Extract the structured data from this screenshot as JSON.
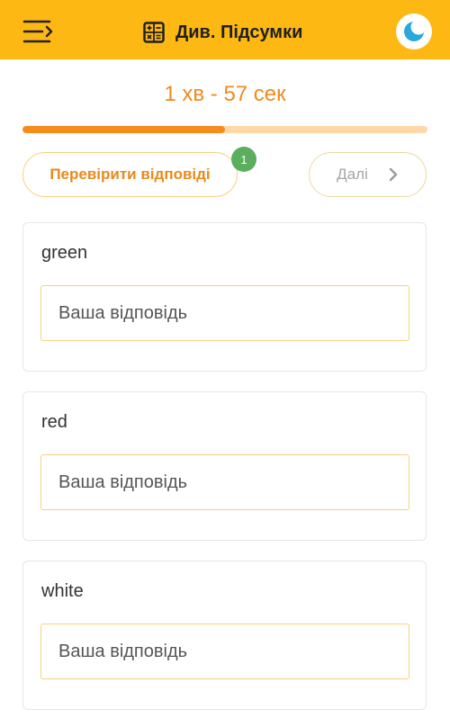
{
  "header": {
    "title": "Див. Підсумки",
    "menu_icon": "menu-arrow-icon",
    "title_icon": "calculator-icon",
    "theme_icon": "moon-icon",
    "color": "#FDB813"
  },
  "quiz": {
    "timer": "1 хв - 57 сек",
    "progress": 0.5,
    "check_label": "Перевірити відповіді",
    "badge_count": "1",
    "next_label": "Далі",
    "next_icon": "chevron-right-icon"
  },
  "cards": [
    {
      "word": "green",
      "placeholder": "Ваша відповідь"
    },
    {
      "word": "red",
      "placeholder": "Ваша відповідь"
    },
    {
      "word": "white",
      "placeholder": "Ваша відповідь"
    }
  ],
  "colors": {
    "accent": "#F68B1E",
    "progress_track": "#FFD8A8",
    "badge": "#5BAE5E",
    "border": "#F5D27A"
  }
}
